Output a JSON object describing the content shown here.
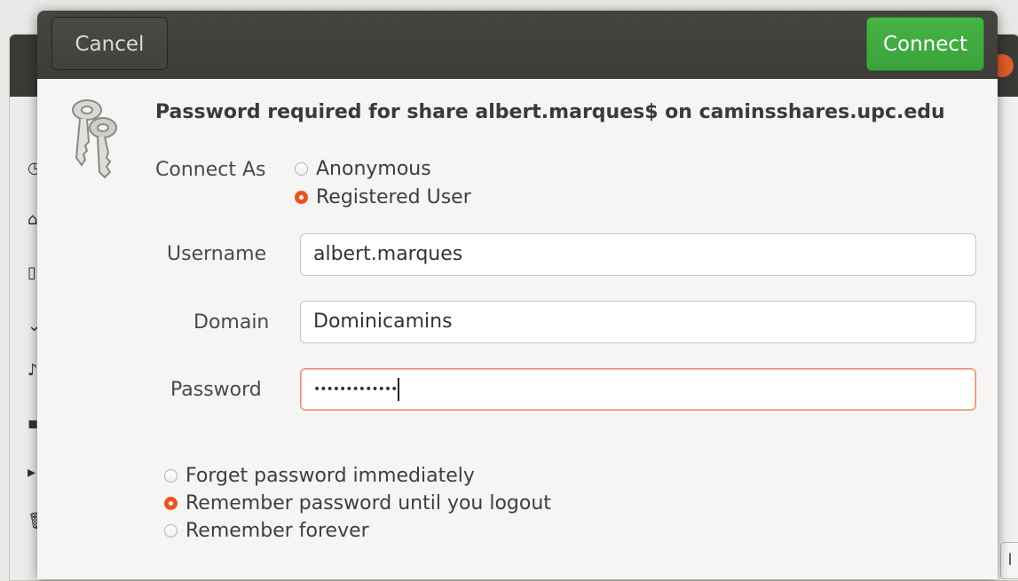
{
  "dialog": {
    "cancel_label": "Cancel",
    "connect_label": "Connect",
    "title": "Password required for share albert.marques$ on caminsshares.upc.edu",
    "connect_as": {
      "label": "Connect As",
      "options": [
        {
          "label": "Anonymous",
          "selected": false
        },
        {
          "label": "Registered User",
          "selected": true
        }
      ]
    },
    "username": {
      "label": "Username",
      "value": "albert.marques"
    },
    "domain": {
      "label": "Domain",
      "value": "Dominicamins"
    },
    "password": {
      "label": "Password",
      "value": "•••••••••••••"
    },
    "remember": {
      "options": [
        {
          "label": "Forget password immediately",
          "selected": false
        },
        {
          "label": "Remember password until you logout",
          "selected": true
        },
        {
          "label": "Remember forever",
          "selected": false
        }
      ]
    }
  },
  "colors": {
    "accent": "#e95420",
    "connect_button": "#3aa23a",
    "headerbar": "#3d3c38"
  },
  "icons": {
    "dialog_icon": "keys-icon"
  }
}
